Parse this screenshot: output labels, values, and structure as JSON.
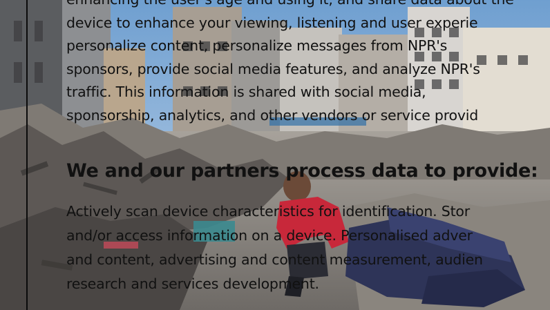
{
  "background_photo": {
    "description_icon": "earthquake-rubble-photo-icon"
  },
  "consent": {
    "paragraph_lines": [
      "enhancing the user's age and using it, and share data about the",
      "device to enhance your viewing, listening and user experie",
      "personalize content, personalize messages from NPR's",
      "sponsors, provide social media features, and analyze NPR's",
      "traffic. This information is shared with social media,",
      "sponsorship, analytics, and other vendors or service provid"
    ],
    "heading": "We and our partners process data to provide:",
    "purposes_lines": [
      "Actively scan device characteristics for identification. Stor",
      "and/or access information on a device. Personalised adver",
      "and content, advertising and content measurement, audien",
      "research and services development."
    ]
  },
  "colors": {
    "text": "#111111",
    "divider": "#0b0b0b"
  }
}
